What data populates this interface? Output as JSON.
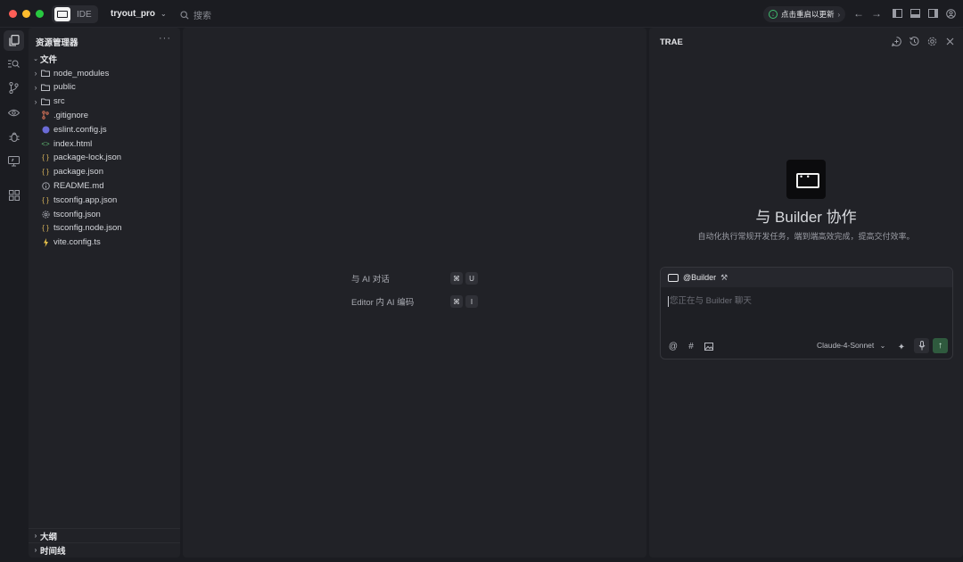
{
  "titlebar": {
    "app_chip_label": "IDE",
    "project_name": "tryout_pro",
    "search_placeholder": "搜索",
    "update_label": "点击重启以更新"
  },
  "explorer": {
    "header": "资源管理器",
    "root_label": "文件",
    "items": [
      {
        "label": "node_modules",
        "kind": "folder",
        "icon": "folder-icon"
      },
      {
        "label": "public",
        "kind": "folder",
        "icon": "folder-icon"
      },
      {
        "label": "src",
        "kind": "folder",
        "icon": "folder-icon"
      },
      {
        "label": ".gitignore",
        "kind": "file",
        "icon": "git-icon",
        "color": "#d9745a"
      },
      {
        "label": "eslint.config.js",
        "kind": "file",
        "icon": "eslint-icon",
        "color": "#6b6bd6"
      },
      {
        "label": "index.html",
        "kind": "file",
        "icon": "html-icon",
        "color": "#5fb872"
      },
      {
        "label": "package-lock.json",
        "kind": "file",
        "icon": "json-icon",
        "color": "#d8b45a"
      },
      {
        "label": "package.json",
        "kind": "file",
        "icon": "json-icon",
        "color": "#d8b45a"
      },
      {
        "label": "README.md",
        "kind": "file",
        "icon": "info-icon",
        "color": "#a0a2aa"
      },
      {
        "label": "tsconfig.app.json",
        "kind": "file",
        "icon": "json-icon",
        "color": "#d8b45a"
      },
      {
        "label": "tsconfig.json",
        "kind": "file",
        "icon": "settings-icon",
        "color": "#a0a2aa"
      },
      {
        "label": "tsconfig.node.json",
        "kind": "file",
        "icon": "json-icon",
        "color": "#d8b45a"
      },
      {
        "label": "vite.config.ts",
        "kind": "file",
        "icon": "vite-icon",
        "color": "#e5c04a"
      }
    ],
    "outline_label": "大纲",
    "timeline_label": "时间线"
  },
  "editor": {
    "hints": [
      {
        "label": "与 AI 对话",
        "keys": [
          "⌘",
          "U"
        ]
      },
      {
        "label": "Editor 内 AI 编码",
        "keys": [
          "⌘",
          "I"
        ]
      }
    ]
  },
  "chat": {
    "title": "TRAE",
    "hero_title": "与 Builder 协作",
    "hero_subtitle": "自动化执行常规开发任务，端到端高效完成，提高交付效率。",
    "agent_tag": "@Builder",
    "input_placeholder": "您正在与 Builder 聊天",
    "model_name": "Claude-4-Sonnet"
  },
  "colors": {
    "accent_green": "#3fbf6f",
    "send_button": "#2f5a3e",
    "panel_bg": "#212227",
    "window_bg": "#1b1c21"
  }
}
